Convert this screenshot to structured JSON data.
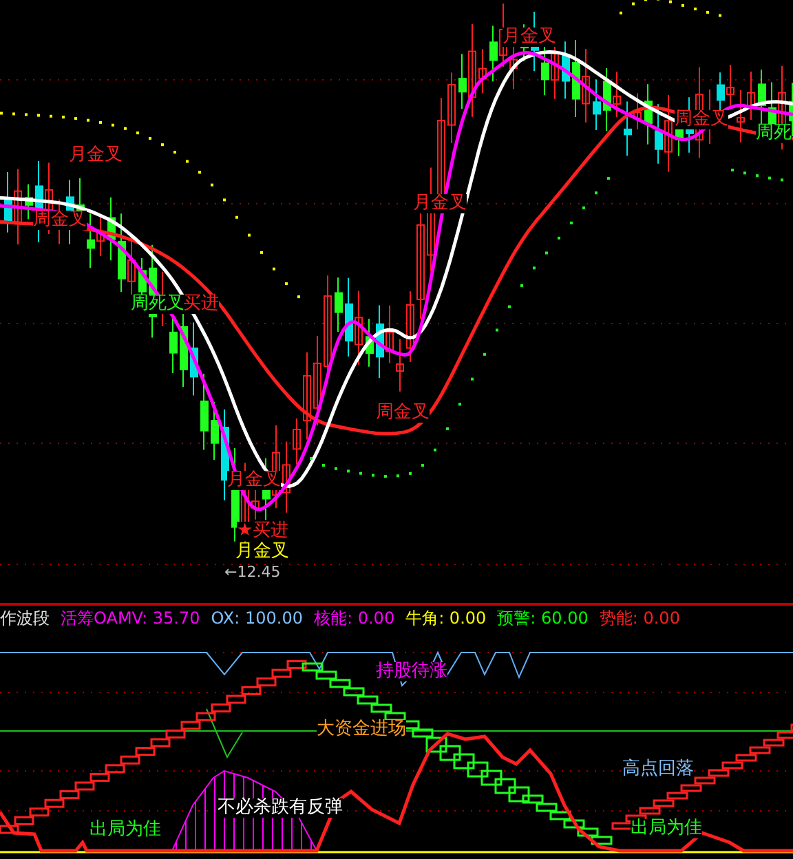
{
  "price_chart": {
    "signals": [
      {
        "text": "月金叉",
        "color": "#ff2020"
      },
      {
        "text": "周金叉",
        "color": "#ff2020"
      },
      {
        "text": "周死叉",
        "color": "#20ff20"
      },
      {
        "text": "买进",
        "color": "#ff2020"
      },
      {
        "text": "月金叉",
        "color": "#ff2020"
      },
      {
        "text": "周金叉",
        "color": "#ff2020"
      },
      {
        "text": "月金叉",
        "color": "#ff2020"
      },
      {
        "text": "★买进",
        "color": "#ff2020"
      },
      {
        "text": "月金叉",
        "color": "#ffff00"
      },
      {
        "text": "月金叉",
        "color": "#ff2020"
      },
      {
        "text": "周金叉",
        "color": "#ff2020"
      },
      {
        "text": "周死",
        "color": "#20ff20"
      }
    ],
    "low_marker": "←12.45"
  },
  "indicator_header": [
    {
      "text": "作波段",
      "color": "#e0e0e0"
    },
    {
      "text": "活筹OAMV: 35.70",
      "color": "#ff00ff"
    },
    {
      "text": "OX: 100.00",
      "color": "#80c0ff"
    },
    {
      "text": "核能: 0.00",
      "color": "#ff00ff"
    },
    {
      "text": "牛角: 0.00",
      "color": "#ffff00"
    },
    {
      "text": "预警: 60.00",
      "color": "#00ff00"
    },
    {
      "text": "势能: 0.00",
      "color": "#ff2020"
    }
  ],
  "indicator_chart": {
    "labels": [
      {
        "text": "持股待涨",
        "color": "#ff00ff"
      },
      {
        "text": "大资金进场",
        "color": "#ffa020"
      },
      {
        "text": "高点回落",
        "color": "#80c0ff"
      },
      {
        "text": "不必杀跌有反弹",
        "color": "#ffffff"
      },
      {
        "text": "出局为佳",
        "color": "#20ff20"
      },
      {
        "text": "出局为佳",
        "color": "#20ff20"
      }
    ]
  }
}
